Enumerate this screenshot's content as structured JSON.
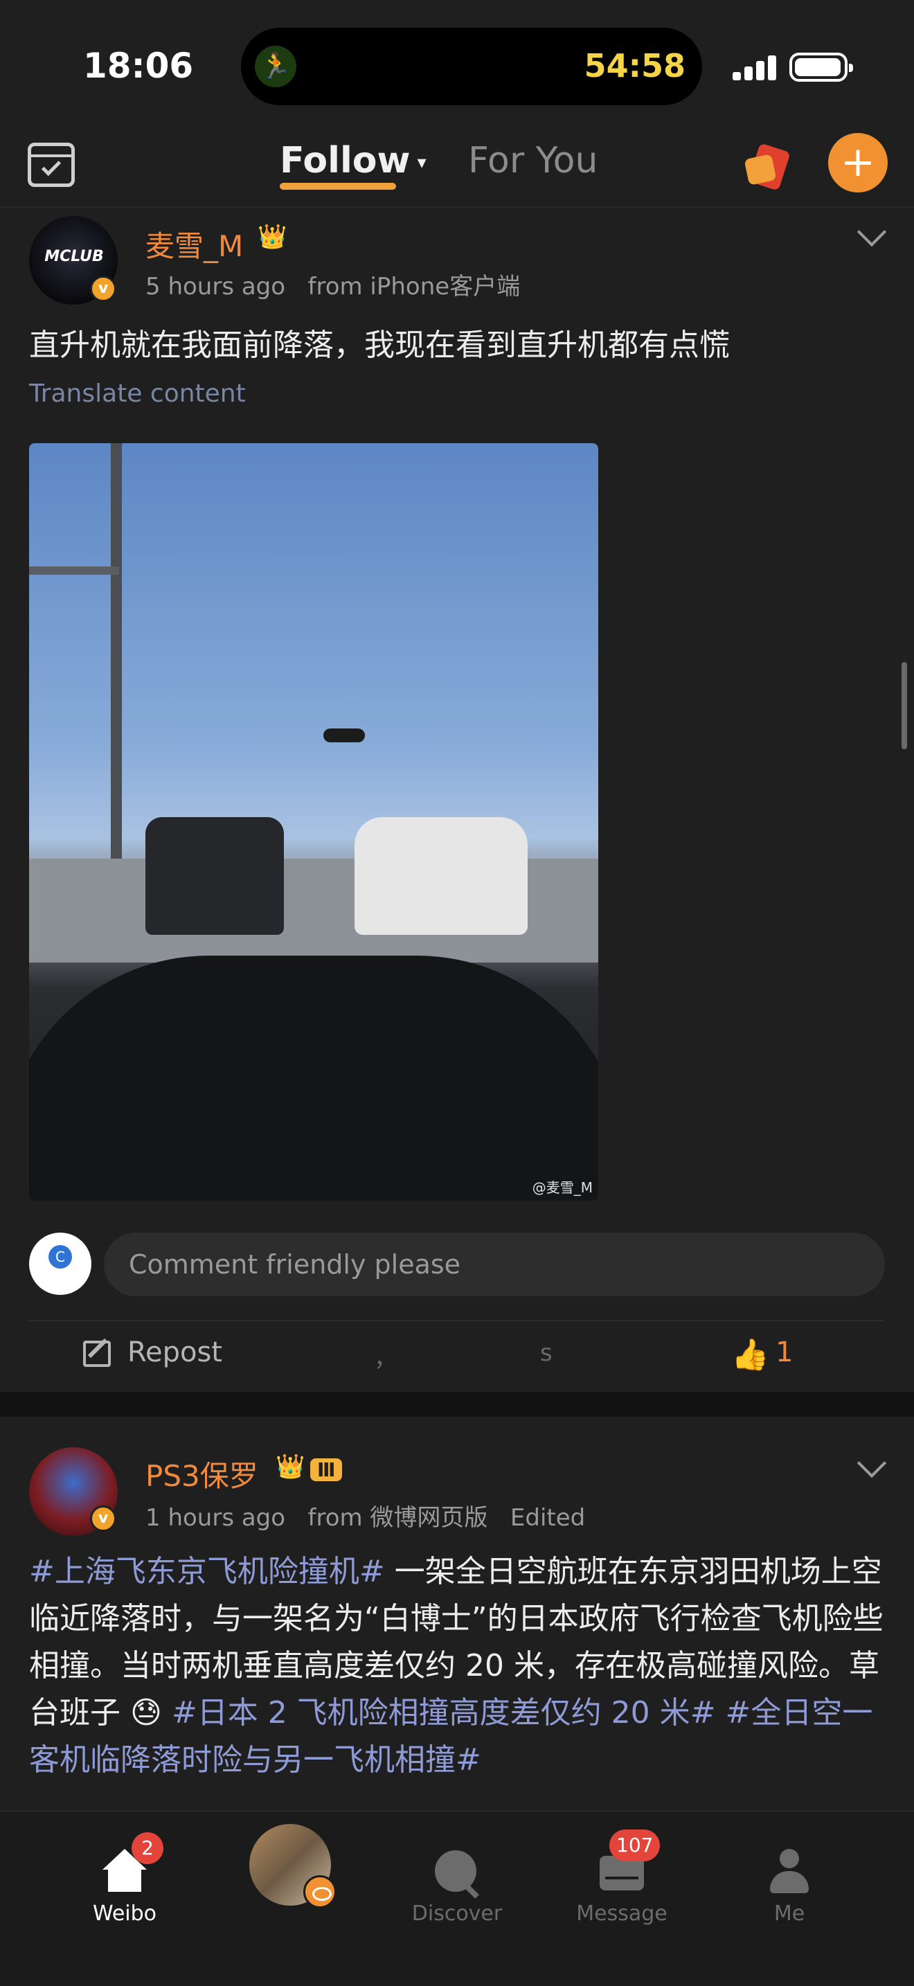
{
  "status_bar": {
    "time": "18:06",
    "activity_timer": "54:58"
  },
  "top_nav": {
    "tabs": [
      {
        "label": "Follow",
        "active": true
      },
      {
        "label": "For You",
        "active": false
      }
    ],
    "icons": [
      "calendar-check-icon",
      "red-packet-icon",
      "add-icon"
    ],
    "accent_color": "#f29131"
  },
  "posts": [
    {
      "username": "麦雪_M",
      "time": "5 hours ago",
      "source": "from iPhone客户端",
      "avatar_text": "MCLUB",
      "text": "直升机就在我面前降落，我现在看到直升机都有点慌",
      "translate_label": "Translate content",
      "image_watermark": "@麦雪_M",
      "comment_placeholder": "Comment friendly please",
      "repost_label": "Repost",
      "like_count": "1",
      "ghost_text_1": "，",
      "ghost_text_2": "s"
    },
    {
      "username": "PS3保罗",
      "level": "Ⅲ",
      "time": "1 hours ago",
      "source": "from 微博网页版",
      "edited": "Edited",
      "hashtag_1": "#上海飞东京飞机险撞机#",
      "body_1": " 一架全日空航班在东京羽田机场上空临近降落时，与一架名为“白博士”的日本政府飞行检查飞机险些相撞。当时两机垂直高度差仅约 20 米，存在极高碰撞风险。草台班子 😓 ",
      "hashtag_2": "#日本 2 飞机险相撞高度差仅约 20 米#",
      "hashtag_3": " #全日空一客机临降落时险与另一飞机相撞#"
    }
  ],
  "tab_bar": {
    "items": [
      {
        "label": "Weibo",
        "badge": "2",
        "active": true
      },
      {
        "label": "",
        "active": false
      },
      {
        "label": "Discover",
        "active": false
      },
      {
        "label": "Message",
        "badge": "107",
        "active": false
      },
      {
        "label": "Me",
        "active": false
      }
    ]
  }
}
